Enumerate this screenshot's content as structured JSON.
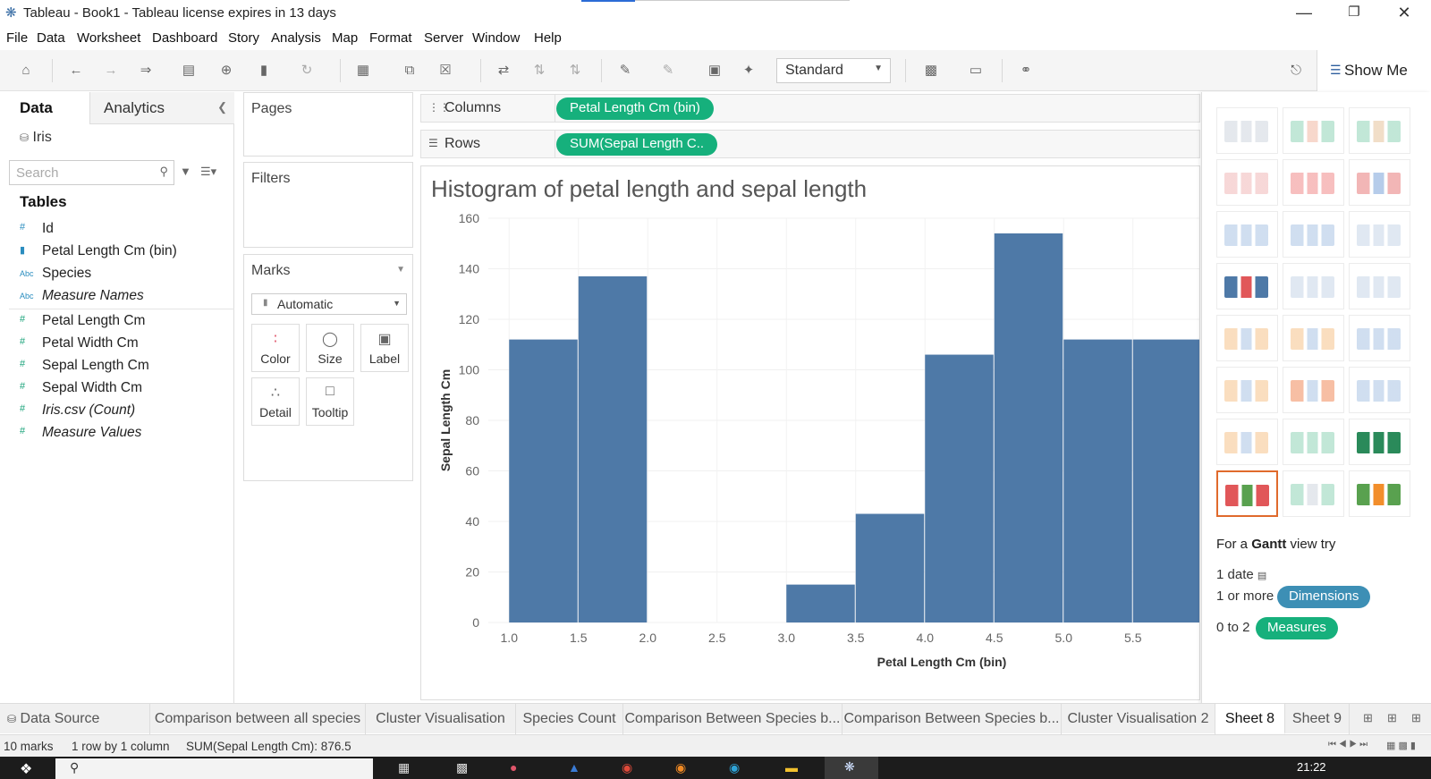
{
  "window": {
    "title": "Tableau - Book1 - Tableau license expires in 13 days",
    "minimize": "—",
    "maximize": "❐",
    "close": "✕"
  },
  "menu": [
    "File",
    "Data",
    "Worksheet",
    "Dashboard",
    "Story",
    "Analysis",
    "Map",
    "Format",
    "Server",
    "Window",
    "Help"
  ],
  "toolbar": {
    "fit_select": "Standard",
    "show_me": "Show Me"
  },
  "data_pane": {
    "tab_data": "Data",
    "tab_analytics": "Analytics",
    "datasource": "Iris",
    "search_placeholder": "Search",
    "tables_heading": "Tables",
    "fields": [
      {
        "label": "Id",
        "type": "#"
      },
      {
        "label": "Petal Length Cm (bin)",
        "type": "bin"
      },
      {
        "label": "Species",
        "type": "Abc"
      },
      {
        "label": "Measure Names",
        "type": "Abc"
      },
      {
        "label": "Petal Length Cm",
        "type": "#"
      },
      {
        "label": "Petal Width Cm",
        "type": "#"
      },
      {
        "label": "Sepal Length Cm",
        "type": "#"
      },
      {
        "label": "Sepal Width Cm",
        "type": "#"
      },
      {
        "label": "Iris.csv (Count)",
        "type": "#"
      },
      {
        "label": "Measure Values",
        "type": "#"
      }
    ]
  },
  "cards": {
    "pages": "Pages",
    "filters": "Filters",
    "marks": "Marks",
    "marks_type": "Automatic",
    "mark_buttons": [
      "Color",
      "Size",
      "Label",
      "Detail",
      "Tooltip"
    ]
  },
  "shelves": {
    "columns_label": "Columns",
    "columns_pill": "Petal Length Cm (bin)",
    "rows_label": "Rows",
    "rows_pill": "SUM(Sepal Length C.."
  },
  "chart_data": {
    "type": "bar",
    "title": "Histogram of petal length and sepal length",
    "xlabel": "Petal Length Cm (bin)",
    "ylabel": "Sepal Length Cm",
    "ylim": [
      0,
      160
    ],
    "yticks": [
      0,
      20,
      40,
      60,
      80,
      100,
      120,
      140,
      160
    ],
    "xticks": [
      "1.0",
      "1.5",
      "2.0",
      "2.5",
      "3.0",
      "3.5",
      "4.0",
      "4.5",
      "5.0",
      "5.5"
    ],
    "x": [
      1.0,
      1.5,
      3.0,
      3.5,
      4.0,
      4.5,
      5.0,
      5.5
    ],
    "values": [
      112,
      137,
      15,
      43,
      106,
      154,
      112,
      112
    ],
    "bin_width": 0.5,
    "bar_color": "#4e79a7"
  },
  "show_me": {
    "hint_prefix": "For a ",
    "hint_bold": "Gantt",
    "hint_suffix": " view try",
    "line1": "1 date",
    "line2": "1 or more",
    "dimensions": "Dimensions",
    "line3": "0 to 2",
    "measures": "Measures",
    "dimensions_color": "#3d8fb5",
    "measures_color": "#16b07c",
    "selected_color": "#e06a2c"
  },
  "sheet_tabs": [
    "Data Source",
    "Comparison between all species",
    "Cluster Visualisation",
    "Species Count",
    "Comparison Between Species b...",
    "Comparison Between Species b...",
    "Cluster Visualisation 2",
    "Sheet 8",
    "Sheet 9"
  ],
  "active_tab": "Sheet 8",
  "status": {
    "marks": "10 marks",
    "rows": "1 row by 1 column",
    "sum": "SUM(Sepal Length Cm): 876.5"
  },
  "taskbar": {
    "time": "21:22"
  }
}
